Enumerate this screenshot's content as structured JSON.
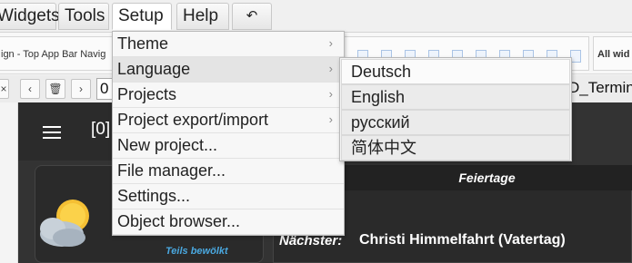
{
  "menubar": {
    "items": [
      {
        "label": "Widgets"
      },
      {
        "label": "Tools"
      },
      {
        "label": "Setup"
      },
      {
        "label": "Help"
      }
    ],
    "undo_glyph": "↶"
  },
  "toolbar": {
    "view_name": "ign - Top App Bar Navig",
    "all_widgets": "All wid"
  },
  "navrow": {
    "prev_glyph": "‹",
    "next_glyph": "›",
    "trash_glyph": "🗑",
    "view_input": "0",
    "right_input": "D_Termin",
    "close_glyph": "×"
  },
  "canvas": {
    "appbar_text": "[0]",
    "weather_label": "Teils bewölkt",
    "holiday": {
      "title": "Feiertage",
      "next_key": "Nächster:",
      "next_value": "Christi Himmelfahrt (Vatertag)"
    }
  },
  "setup_menu": {
    "items": [
      {
        "label": "Theme",
        "submenu": true
      },
      {
        "label": "Language",
        "submenu": true
      },
      {
        "label": "Projects",
        "submenu": true
      },
      {
        "label": "Project export/import",
        "submenu": true
      },
      {
        "label": "New project...",
        "submenu": false
      },
      {
        "label": "File manager...",
        "submenu": false
      },
      {
        "label": "Settings...",
        "submenu": false
      },
      {
        "label": "Object browser...",
        "submenu": false
      }
    ],
    "arrow_glyph": "›"
  },
  "language_menu": {
    "items": [
      {
        "label": "Deutsch"
      },
      {
        "label": "English"
      },
      {
        "label": "русский"
      },
      {
        "label": "简体中文"
      }
    ]
  }
}
